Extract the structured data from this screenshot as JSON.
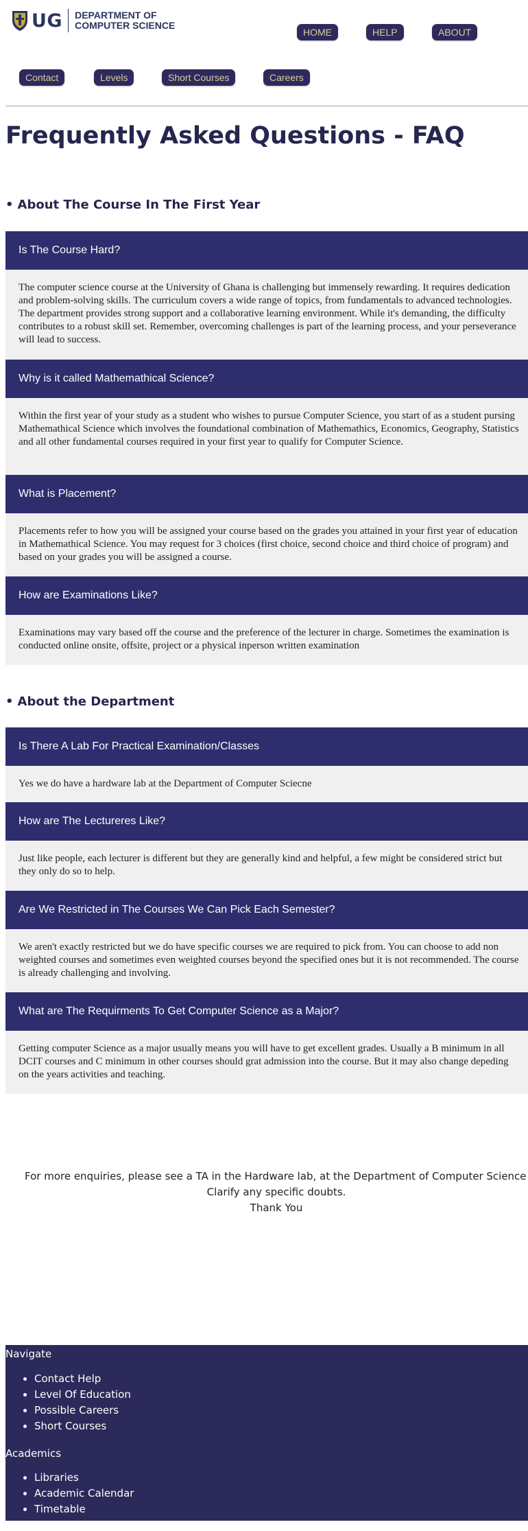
{
  "header": {
    "logo_text": "UG",
    "dept_line1": "DEPARTMENT OF",
    "dept_line2": "COMPUTER SCIENCE",
    "top_nav": [
      "HOME",
      "HELP",
      "ABOUT"
    ],
    "sub_nav": [
      "Contact",
      "Levels",
      "Short Courses",
      "Careers"
    ]
  },
  "colors": {
    "primary_navy": "#2e2e6e",
    "pill_bg": "#2e2a5c",
    "pill_text": "#d9cc9e",
    "answer_bg": "#f0f0f0",
    "footer_bg": "#2b2a5a"
  },
  "page": {
    "title": "Frequently Asked Questions - FAQ"
  },
  "sections": [
    {
      "heading": "About The Course In The First Year",
      "items": [
        {
          "q": "Is The Course Hard?",
          "a": "The computer science course at the University of Ghana is challenging but immensely rewarding. It requires dedication and problem-solving skills. The curriculum covers a wide range of topics, from fundamentals to advanced technologies. The department provides strong support and a collaborative learning environment. While it's demanding, the difficulty contributes to a robust skill set. Remember, overcoming challenges is part of the learning process, and your perseverance will lead to success."
        },
        {
          "q": "Why is it called Mathemathical Science?",
          "a": "Within the first year of your study as a student who wishes to pursue Computer Science, you start of as a student pursing Mathemathical Science which involves the foundational combination of Mathemathics, Economics, Geography, Statistics and all other fundamental courses required in your first year to qualify for Computer Science."
        },
        {
          "q": "What is Placement?",
          "a": "Placements refer to how you will be assigned your course based on the grades you attained in your first year of education in Mathemathical Science. You may request for 3 choices (first choice, second choice and third choice of program) and based on your grades you will be assigned a course."
        },
        {
          "q": "How are Examinations Like?",
          "a": "Examinations may vary based off the course and the preference of the lecturer in charge. Sometimes the examination is conducted online onsite, offsite, project or a physical inperson written examination"
        }
      ]
    },
    {
      "heading": "About the Department",
      "items": [
        {
          "q": "Is There A Lab For Practical Examination/Classes",
          "a": "Yes we do have a hardware lab at the Department of Computer Sciecne"
        },
        {
          "q": "How are The Lectureres Like?",
          "a": "Just like people, each lecturer is different but they are generally kind and helpful, a few might be considered strict but they only do so to help."
        },
        {
          "q": "Are We Restricted in The Courses We Can Pick Each Semester?",
          "a": "We aren't exactly restricted but we do have specific courses we are required to pick from. You can choose to add non weighted courses and sometimes even weighted courses beyond the specified ones but it is not recommended. The course is already challenging and involving."
        },
        {
          "q": "What are The Requirments To Get Computer Science as a Major?",
          "a": "Getting computer Science as a major usually means you will have to get excellent grades. Usually a B minimum in all DCIT courses and C minimum in other courses should grat admission into the course. But it may also change depeding on the years activities and teaching."
        }
      ]
    }
  ],
  "enquiry": {
    "line1": "For more enquiries, please see a TA in the Hardware lab, at the Department of Computer Science to",
    "line2": "Clarify any specific doubts.",
    "line3": "Thank You"
  },
  "footer": {
    "navigate_heading": "Navigate",
    "navigate_links": [
      "Contact Help",
      "Level Of Education",
      "Possible Careers",
      "Short Courses"
    ],
    "academics_heading": "Academics",
    "academics_links": [
      "Libraries",
      "Academic Calendar",
      "Timetable"
    ]
  }
}
